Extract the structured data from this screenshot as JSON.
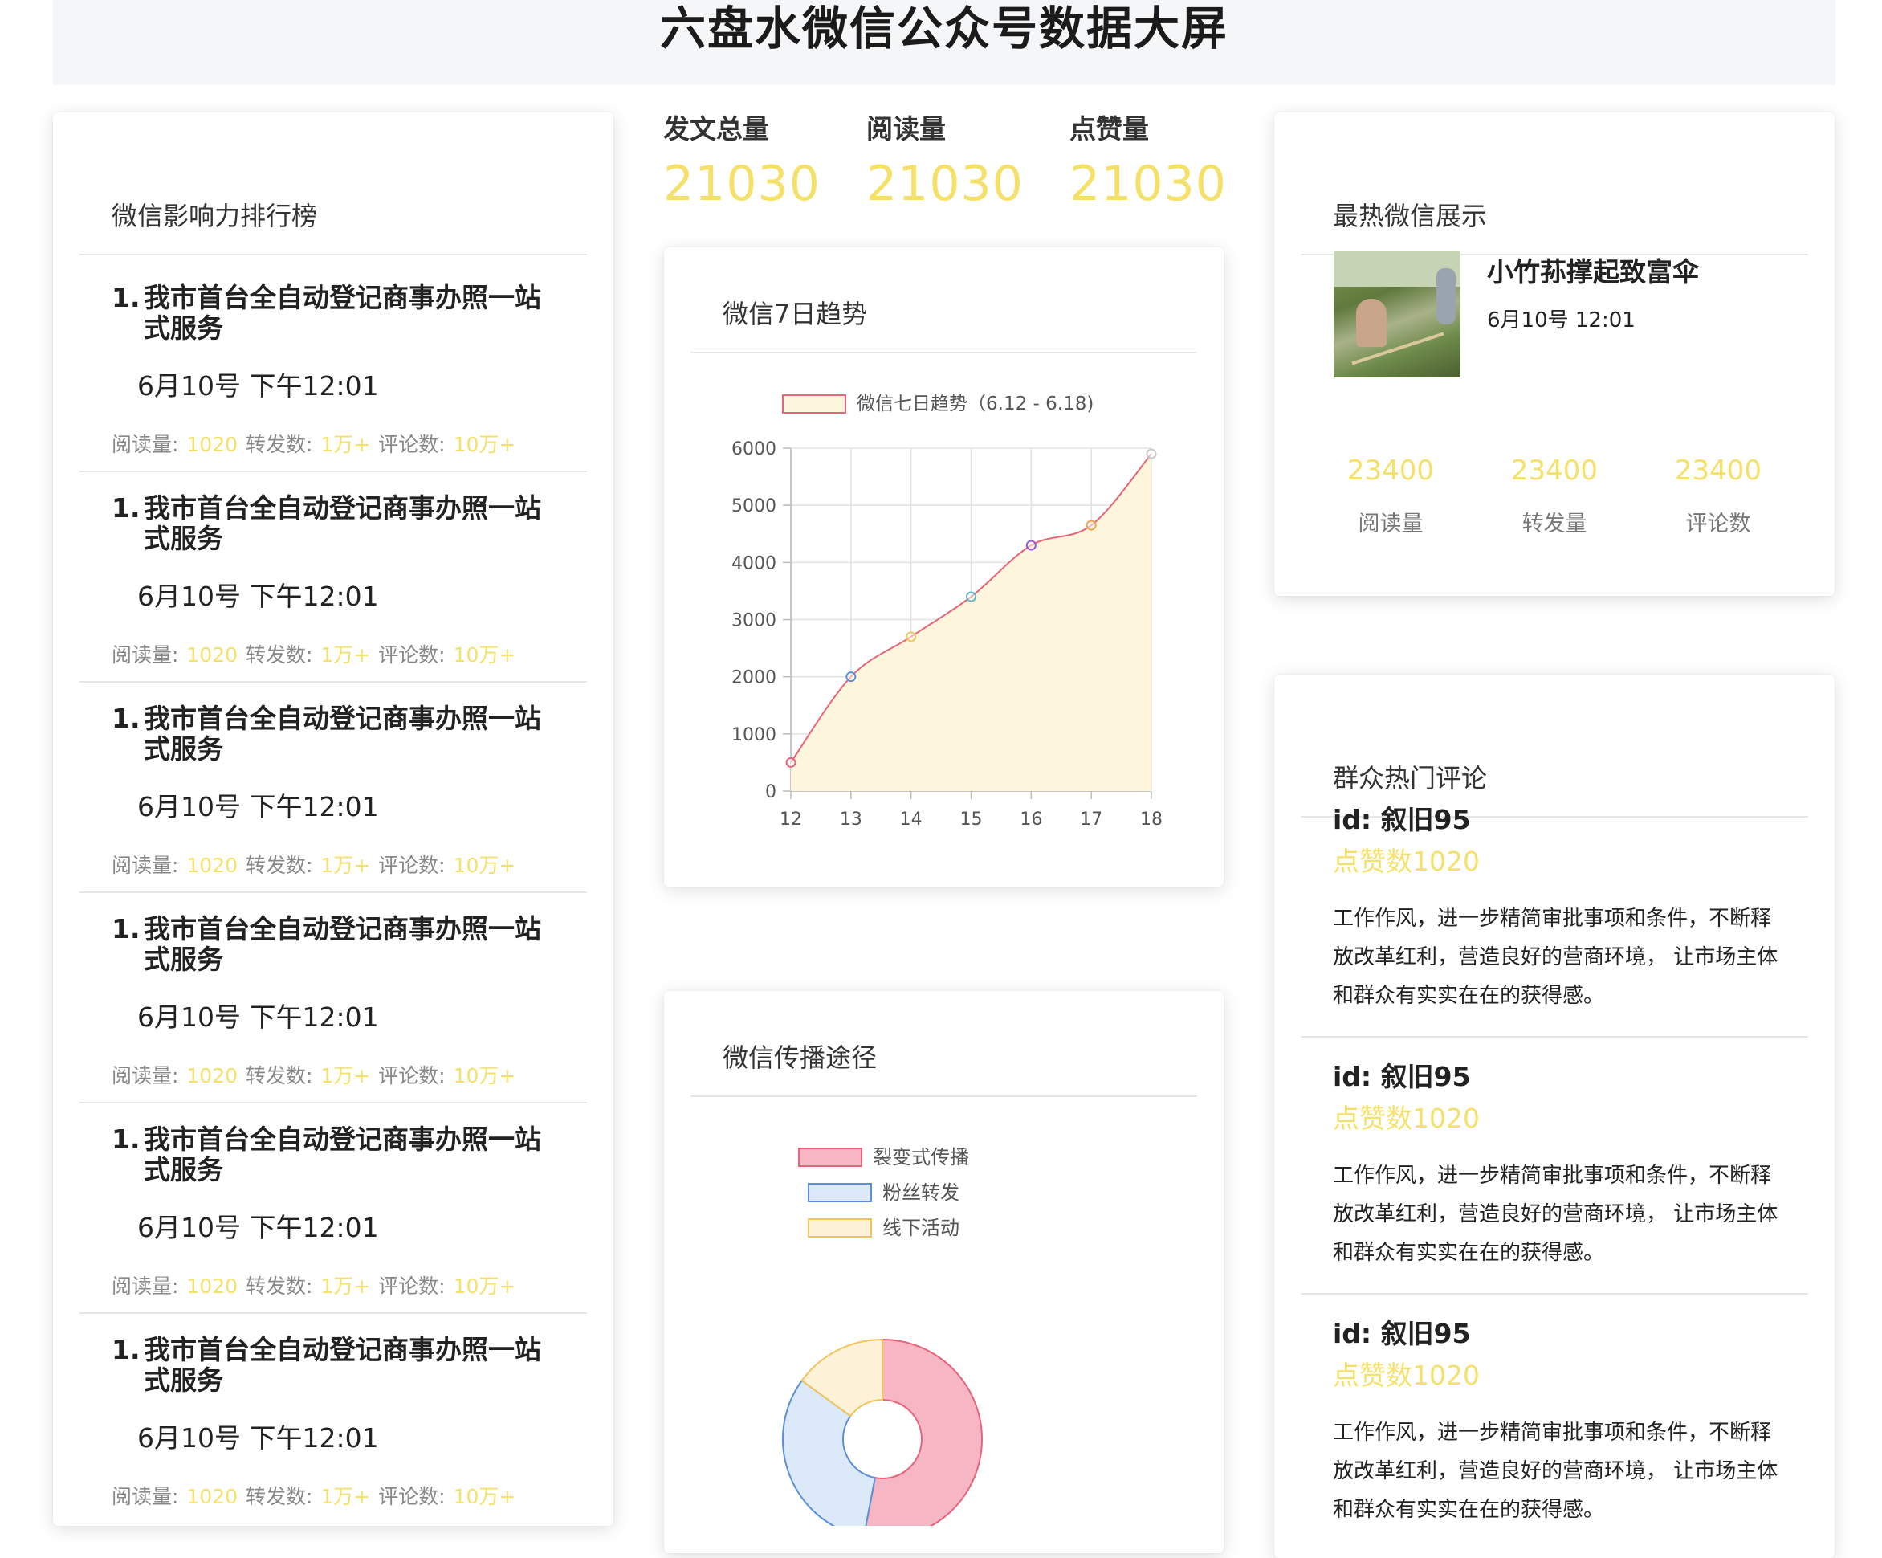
{
  "header": {
    "title": "六盘水微信公众号数据大屏"
  },
  "ranking": {
    "title": "微信影响力排行榜",
    "items": [
      {
        "num": "1.",
        "title": "我市首台全自动登记商事办照一站式服务",
        "date": "6月10号 下午12:01",
        "read_label": "阅读量:",
        "read": "1020",
        "share_label": "转发数:",
        "share": "1万+",
        "comment_label": "评论数:",
        "comment": "10万+"
      },
      {
        "num": "1.",
        "title": "我市首台全自动登记商事办照一站式服务",
        "date": "6月10号 下午12:01",
        "read_label": "阅读量:",
        "read": "1020",
        "share_label": "转发数:",
        "share": "1万+",
        "comment_label": "评论数:",
        "comment": "10万+"
      },
      {
        "num": "1.",
        "title": "我市首台全自动登记商事办照一站式服务",
        "date": "6月10号 下午12:01",
        "read_label": "阅读量:",
        "read": "1020",
        "share_label": "转发数:",
        "share": "1万+",
        "comment_label": "评论数:",
        "comment": "10万+"
      },
      {
        "num": "1.",
        "title": "我市首台全自动登记商事办照一站式服务",
        "date": "6月10号 下午12:01",
        "read_label": "阅读量:",
        "read": "1020",
        "share_label": "转发数:",
        "share": "1万+",
        "comment_label": "评论数:",
        "comment": "10万+"
      },
      {
        "num": "1.",
        "title": "我市首台全自动登记商事办照一站式服务",
        "date": "6月10号 下午12:01",
        "read_label": "阅读量:",
        "read": "1020",
        "share_label": "转发数:",
        "share": "1万+",
        "comment_label": "评论数:",
        "comment": "10万+"
      },
      {
        "num": "1.",
        "title": "我市首台全自动登记商事办照一站式服务",
        "date": "6月10号 下午12:01",
        "read_label": "阅读量:",
        "read": "1020",
        "share_label": "转发数:",
        "share": "1万+",
        "comment_label": "评论数:",
        "comment": "10万+"
      }
    ]
  },
  "stats": [
    {
      "label": "发文总量",
      "value": "21030"
    },
    {
      "label": "阅读量",
      "value": "21030"
    },
    {
      "label": "点赞量",
      "value": "21030"
    }
  ],
  "trend": {
    "title": "微信7日趋势"
  },
  "spread": {
    "title": "微信传播途径"
  },
  "hot": {
    "title": "最热微信展示",
    "name": "小竹荪撑起致富伞",
    "date": "6月10号 12:01",
    "stats": [
      {
        "value": "23400",
        "label": "阅读量"
      },
      {
        "value": "23400",
        "label": "转发量"
      },
      {
        "value": "23400",
        "label": "评论数"
      }
    ]
  },
  "comments": {
    "title": "群众热门评论",
    "items": [
      {
        "id": "id: 叙旧95",
        "likes": "点赞数1020",
        "text": "工作作风，进一步精简审批事项和条件，不断释放改革红利，营造良好的营商环境， 让市场主体和群众有实实在在的获得感。"
      },
      {
        "id": "id: 叙旧95",
        "likes": "点赞数1020",
        "text": "工作作风，进一步精简审批事项和条件，不断释放改革红利，营造良好的营商环境， 让市场主体和群众有实实在在的获得感。"
      },
      {
        "id": "id: 叙旧95",
        "likes": "点赞数1020",
        "text": "工作作风，进一步精简审批事项和条件，不断释放改革红利，营造良好的营商环境， 让市场主体和群众有实实在在的获得感。"
      }
    ]
  },
  "chart_data": [
    {
      "type": "line",
      "title": "",
      "series": [
        {
          "name": "微信七日趋势（6.12 - 6.18)",
          "values": [
            500,
            2000,
            2700,
            3400,
            4300,
            4650,
            5900
          ]
        }
      ],
      "x": [
        12,
        13,
        14,
        15,
        16,
        17,
        18
      ],
      "x_labels": [
        "12",
        "13",
        "14",
        "15",
        "16",
        "17",
        "18"
      ],
      "y_ticks": [
        "0",
        "1000",
        "2000",
        "3000",
        "4000",
        "5000",
        "6000"
      ],
      "ylim": [
        0,
        6000
      ],
      "point_colors": [
        "#e8647a",
        "#5b8fd9",
        "#f2c45a",
        "#5fb8c7",
        "#9b59d6",
        "#f5a24b",
        "#c9c9c9"
      ],
      "line_color": "#e8647a",
      "fill_color": "#fdf5dc",
      "grid": true,
      "legend": "top"
    },
    {
      "type": "pie",
      "title": "",
      "labels": [
        "裂变式传播",
        "粉丝转发",
        "线下活动"
      ],
      "values": [
        53,
        32,
        15
      ],
      "colors": [
        "#f6b6c4",
        "#dbe9f8",
        "#fdf2d8"
      ],
      "border_colors": [
        "#e8647a",
        "#5b8fd9",
        "#f2c45a"
      ],
      "legend": "top"
    }
  ]
}
